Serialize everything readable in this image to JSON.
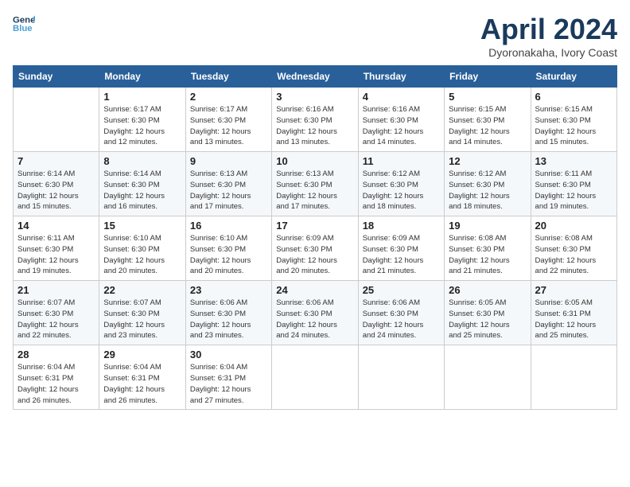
{
  "header": {
    "logo_line1": "General",
    "logo_line2": "Blue",
    "month_title": "April 2024",
    "subtitle": "Dyoronakaha, Ivory Coast"
  },
  "weekdays": [
    "Sunday",
    "Monday",
    "Tuesday",
    "Wednesday",
    "Thursday",
    "Friday",
    "Saturday"
  ],
  "weeks": [
    [
      {
        "day": "",
        "info": ""
      },
      {
        "day": "1",
        "info": "Sunrise: 6:17 AM\nSunset: 6:30 PM\nDaylight: 12 hours\nand 12 minutes."
      },
      {
        "day": "2",
        "info": "Sunrise: 6:17 AM\nSunset: 6:30 PM\nDaylight: 12 hours\nand 13 minutes."
      },
      {
        "day": "3",
        "info": "Sunrise: 6:16 AM\nSunset: 6:30 PM\nDaylight: 12 hours\nand 13 minutes."
      },
      {
        "day": "4",
        "info": "Sunrise: 6:16 AM\nSunset: 6:30 PM\nDaylight: 12 hours\nand 14 minutes."
      },
      {
        "day": "5",
        "info": "Sunrise: 6:15 AM\nSunset: 6:30 PM\nDaylight: 12 hours\nand 14 minutes."
      },
      {
        "day": "6",
        "info": "Sunrise: 6:15 AM\nSunset: 6:30 PM\nDaylight: 12 hours\nand 15 minutes."
      }
    ],
    [
      {
        "day": "7",
        "info": "Sunrise: 6:14 AM\nSunset: 6:30 PM\nDaylight: 12 hours\nand 15 minutes."
      },
      {
        "day": "8",
        "info": "Sunrise: 6:14 AM\nSunset: 6:30 PM\nDaylight: 12 hours\nand 16 minutes."
      },
      {
        "day": "9",
        "info": "Sunrise: 6:13 AM\nSunset: 6:30 PM\nDaylight: 12 hours\nand 17 minutes."
      },
      {
        "day": "10",
        "info": "Sunrise: 6:13 AM\nSunset: 6:30 PM\nDaylight: 12 hours\nand 17 minutes."
      },
      {
        "day": "11",
        "info": "Sunrise: 6:12 AM\nSunset: 6:30 PM\nDaylight: 12 hours\nand 18 minutes."
      },
      {
        "day": "12",
        "info": "Sunrise: 6:12 AM\nSunset: 6:30 PM\nDaylight: 12 hours\nand 18 minutes."
      },
      {
        "day": "13",
        "info": "Sunrise: 6:11 AM\nSunset: 6:30 PM\nDaylight: 12 hours\nand 19 minutes."
      }
    ],
    [
      {
        "day": "14",
        "info": "Sunrise: 6:11 AM\nSunset: 6:30 PM\nDaylight: 12 hours\nand 19 minutes."
      },
      {
        "day": "15",
        "info": "Sunrise: 6:10 AM\nSunset: 6:30 PM\nDaylight: 12 hours\nand 20 minutes."
      },
      {
        "day": "16",
        "info": "Sunrise: 6:10 AM\nSunset: 6:30 PM\nDaylight: 12 hours\nand 20 minutes."
      },
      {
        "day": "17",
        "info": "Sunrise: 6:09 AM\nSunset: 6:30 PM\nDaylight: 12 hours\nand 20 minutes."
      },
      {
        "day": "18",
        "info": "Sunrise: 6:09 AM\nSunset: 6:30 PM\nDaylight: 12 hours\nand 21 minutes."
      },
      {
        "day": "19",
        "info": "Sunrise: 6:08 AM\nSunset: 6:30 PM\nDaylight: 12 hours\nand 21 minutes."
      },
      {
        "day": "20",
        "info": "Sunrise: 6:08 AM\nSunset: 6:30 PM\nDaylight: 12 hours\nand 22 minutes."
      }
    ],
    [
      {
        "day": "21",
        "info": "Sunrise: 6:07 AM\nSunset: 6:30 PM\nDaylight: 12 hours\nand 22 minutes."
      },
      {
        "day": "22",
        "info": "Sunrise: 6:07 AM\nSunset: 6:30 PM\nDaylight: 12 hours\nand 23 minutes."
      },
      {
        "day": "23",
        "info": "Sunrise: 6:06 AM\nSunset: 6:30 PM\nDaylight: 12 hours\nand 23 minutes."
      },
      {
        "day": "24",
        "info": "Sunrise: 6:06 AM\nSunset: 6:30 PM\nDaylight: 12 hours\nand 24 minutes."
      },
      {
        "day": "25",
        "info": "Sunrise: 6:06 AM\nSunset: 6:30 PM\nDaylight: 12 hours\nand 24 minutes."
      },
      {
        "day": "26",
        "info": "Sunrise: 6:05 AM\nSunset: 6:30 PM\nDaylight: 12 hours\nand 25 minutes."
      },
      {
        "day": "27",
        "info": "Sunrise: 6:05 AM\nSunset: 6:31 PM\nDaylight: 12 hours\nand 25 minutes."
      }
    ],
    [
      {
        "day": "28",
        "info": "Sunrise: 6:04 AM\nSunset: 6:31 PM\nDaylight: 12 hours\nand 26 minutes."
      },
      {
        "day": "29",
        "info": "Sunrise: 6:04 AM\nSunset: 6:31 PM\nDaylight: 12 hours\nand 26 minutes."
      },
      {
        "day": "30",
        "info": "Sunrise: 6:04 AM\nSunset: 6:31 PM\nDaylight: 12 hours\nand 27 minutes."
      },
      {
        "day": "",
        "info": ""
      },
      {
        "day": "",
        "info": ""
      },
      {
        "day": "",
        "info": ""
      },
      {
        "day": "",
        "info": ""
      }
    ]
  ]
}
